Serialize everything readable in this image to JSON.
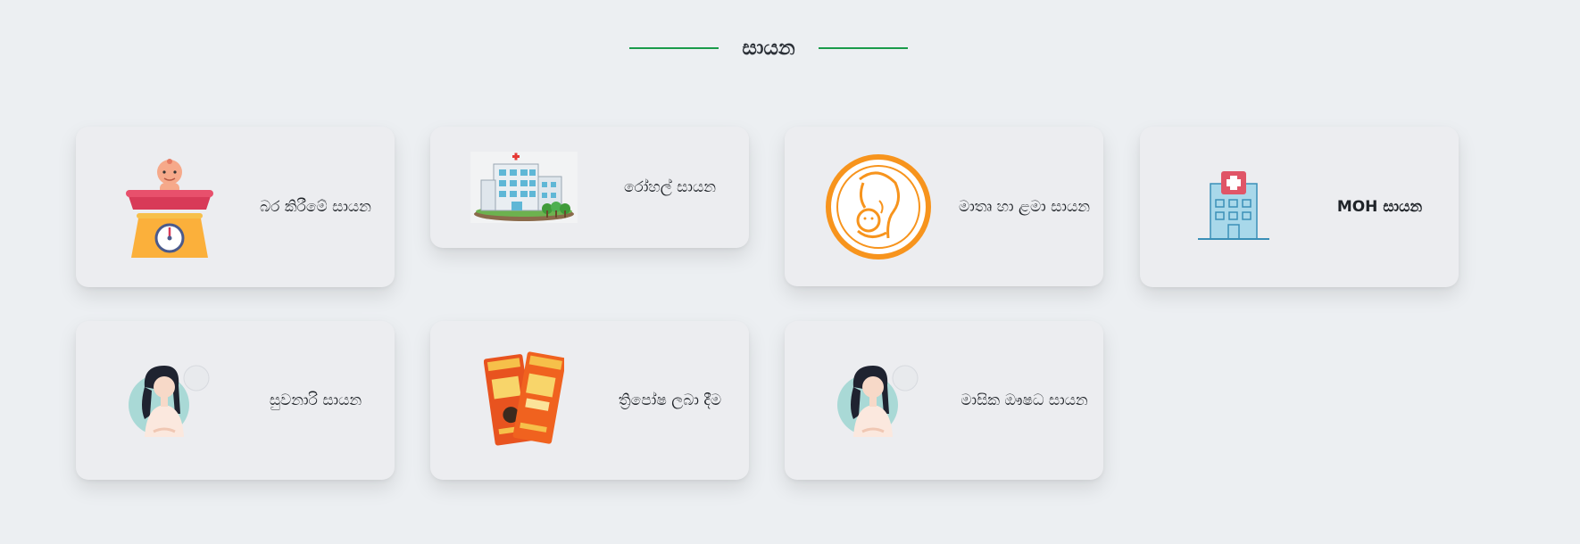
{
  "section": {
    "title": "සායන"
  },
  "cards": [
    {
      "label": "බර කිරීමේ සායන",
      "icon": "baby-scale-icon"
    },
    {
      "label": "රෝහල් සායන",
      "icon": "hospital-building-icon"
    },
    {
      "label": "මාතෘ හා ළමා සායන",
      "icon": "mother-child-icon"
    },
    {
      "label": "MOH සායන",
      "icon": "medical-building-icon"
    },
    {
      "label": "සුවනාරි සායන",
      "icon": "woman-avatar-icon"
    },
    {
      "label": "ත්‍රිපෝෂ ලබා දීම",
      "icon": "thriposha-packets-icon"
    },
    {
      "label": "මාසික ඖෂධ සායන",
      "icon": "woman-avatar-icon"
    }
  ],
  "colors": {
    "accent_line": "#1a9b4b",
    "card_bg": "#ecedf0",
    "page_bg": "#eceff2"
  }
}
